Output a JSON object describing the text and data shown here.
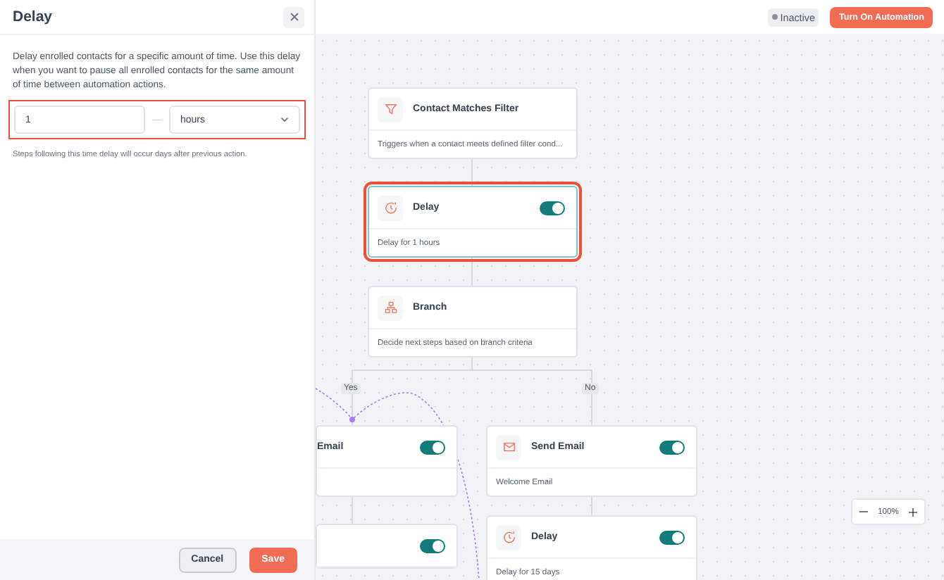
{
  "panel": {
    "title": "Delay",
    "description": "Delay enrolled contacts for a specific amount of time. Use this delay when you want to pause all enrolled contacts for the same amount of time between automation actions.",
    "duration": {
      "value": "1",
      "separator": "—",
      "unit": "hours",
      "invalid": true
    },
    "hint": "Steps following this time delay will occur days after previous action.",
    "buttons": [
      {
        "kind": "secondary",
        "label": "Cancel"
      },
      {
        "kind": "primary",
        "label": "Save"
      }
    ]
  },
  "topbar": {
    "status": "Inactive",
    "action": "Turn On Automation"
  },
  "nodes": [
    {
      "kind": "filter",
      "title": "Contact Matches Filter",
      "subtitle": "Triggers when a contact meets defined filter cond...",
      "selected": false
    },
    {
      "kind": "delay",
      "title": "Delay",
      "subtitle": "Delay for 1 hours",
      "enabled": true,
      "selected": true
    },
    {
      "kind": "branch",
      "title": "Branch",
      "subtitle": "Decide next steps based on branch criteria",
      "selected": false
    },
    {
      "kind": "email-partial",
      "title": "Email",
      "enabled": true,
      "selected": false
    },
    {
      "kind": "email",
      "title": "Send Email",
      "subtitle": "Welcome Email",
      "enabled": true,
      "selected": false
    },
    {
      "kind": "hidden",
      "enabled": true,
      "selected": false
    },
    {
      "kind": "delay",
      "title": "Delay",
      "subtitle": "Delay for 15 days",
      "enabled": true,
      "selected": false
    }
  ],
  "branch_labels": [
    "Yes",
    "No"
  ],
  "zoom": {
    "label": "100%"
  }
}
